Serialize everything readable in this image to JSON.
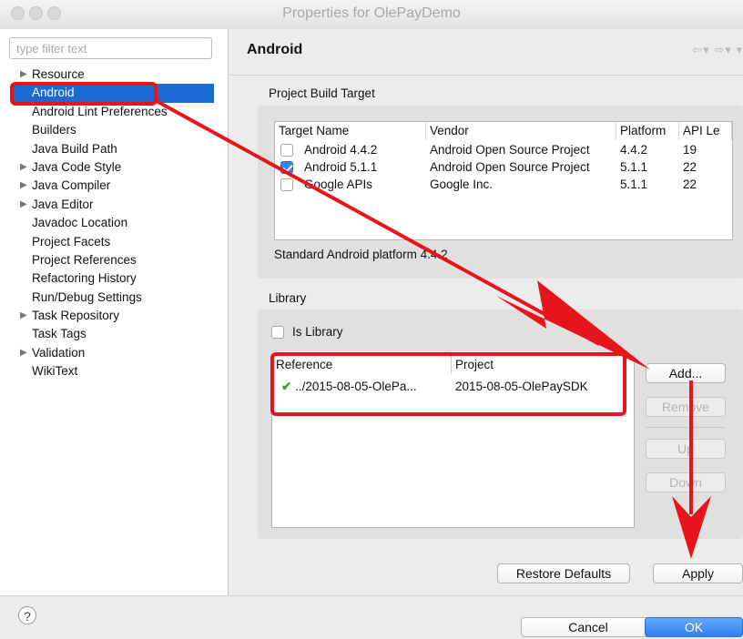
{
  "window": {
    "title": "Properties for OlePayDemo"
  },
  "sidebar": {
    "filter_placeholder": "type filter text",
    "items": [
      {
        "label": "Resource",
        "expandable": true
      },
      {
        "label": "Android",
        "selected": true
      },
      {
        "label": "Android Lint Preferences"
      },
      {
        "label": "Builders"
      },
      {
        "label": "Java Build Path"
      },
      {
        "label": "Java Code Style",
        "expandable": true
      },
      {
        "label": "Java Compiler",
        "expandable": true
      },
      {
        "label": "Java Editor",
        "expandable": true
      },
      {
        "label": "Javadoc Location"
      },
      {
        "label": "Project Facets"
      },
      {
        "label": "Project References"
      },
      {
        "label": "Refactoring History"
      },
      {
        "label": "Run/Debug Settings"
      },
      {
        "label": "Task Repository",
        "expandable": true
      },
      {
        "label": "Task Tags"
      },
      {
        "label": "Validation",
        "expandable": true
      },
      {
        "label": "WikiText"
      }
    ]
  },
  "page": {
    "title": "Android",
    "nav_icons": [
      "back-arrow-icon",
      "forward-arrow-icon",
      "menu-chevron-icon"
    ]
  },
  "build_target": {
    "group_label": "Project Build Target",
    "columns": [
      "Target Name",
      "Vendor",
      "Platform",
      "API Le"
    ],
    "rows": [
      {
        "checked": false,
        "name": "Android 4.4.2",
        "vendor": "Android Open Source Project",
        "platform": "4.4.2",
        "api": "19"
      },
      {
        "checked": true,
        "name": "Android 5.1.1",
        "vendor": "Android Open Source Project",
        "platform": "5.1.1",
        "api": "22"
      },
      {
        "checked": false,
        "name": "Google APIs",
        "vendor": "Google Inc.",
        "platform": "5.1.1",
        "api": "22"
      }
    ],
    "description": "Standard Android platform 4.4.2"
  },
  "library": {
    "group_label": "Library",
    "is_library_label": "Is Library",
    "is_library_checked": false,
    "columns": [
      "Reference",
      "Project"
    ],
    "rows": [
      {
        "status_icon": "check-icon",
        "reference": "../2015-08-05-OlePa...",
        "project": "2015-08-05-OlePaySDK"
      }
    ],
    "buttons": {
      "add": "Add...",
      "remove": "Remove",
      "up": "Up",
      "down": "Down"
    }
  },
  "footer": {
    "restore_defaults": "Restore Defaults",
    "apply": "Apply",
    "cancel": "Cancel",
    "ok": "OK",
    "help": "?"
  },
  "colors": {
    "selection": "#1b6ad4",
    "annotation": "#e8141b",
    "primary_button": "#3b87f0",
    "check_green": "#2aa52a"
  }
}
